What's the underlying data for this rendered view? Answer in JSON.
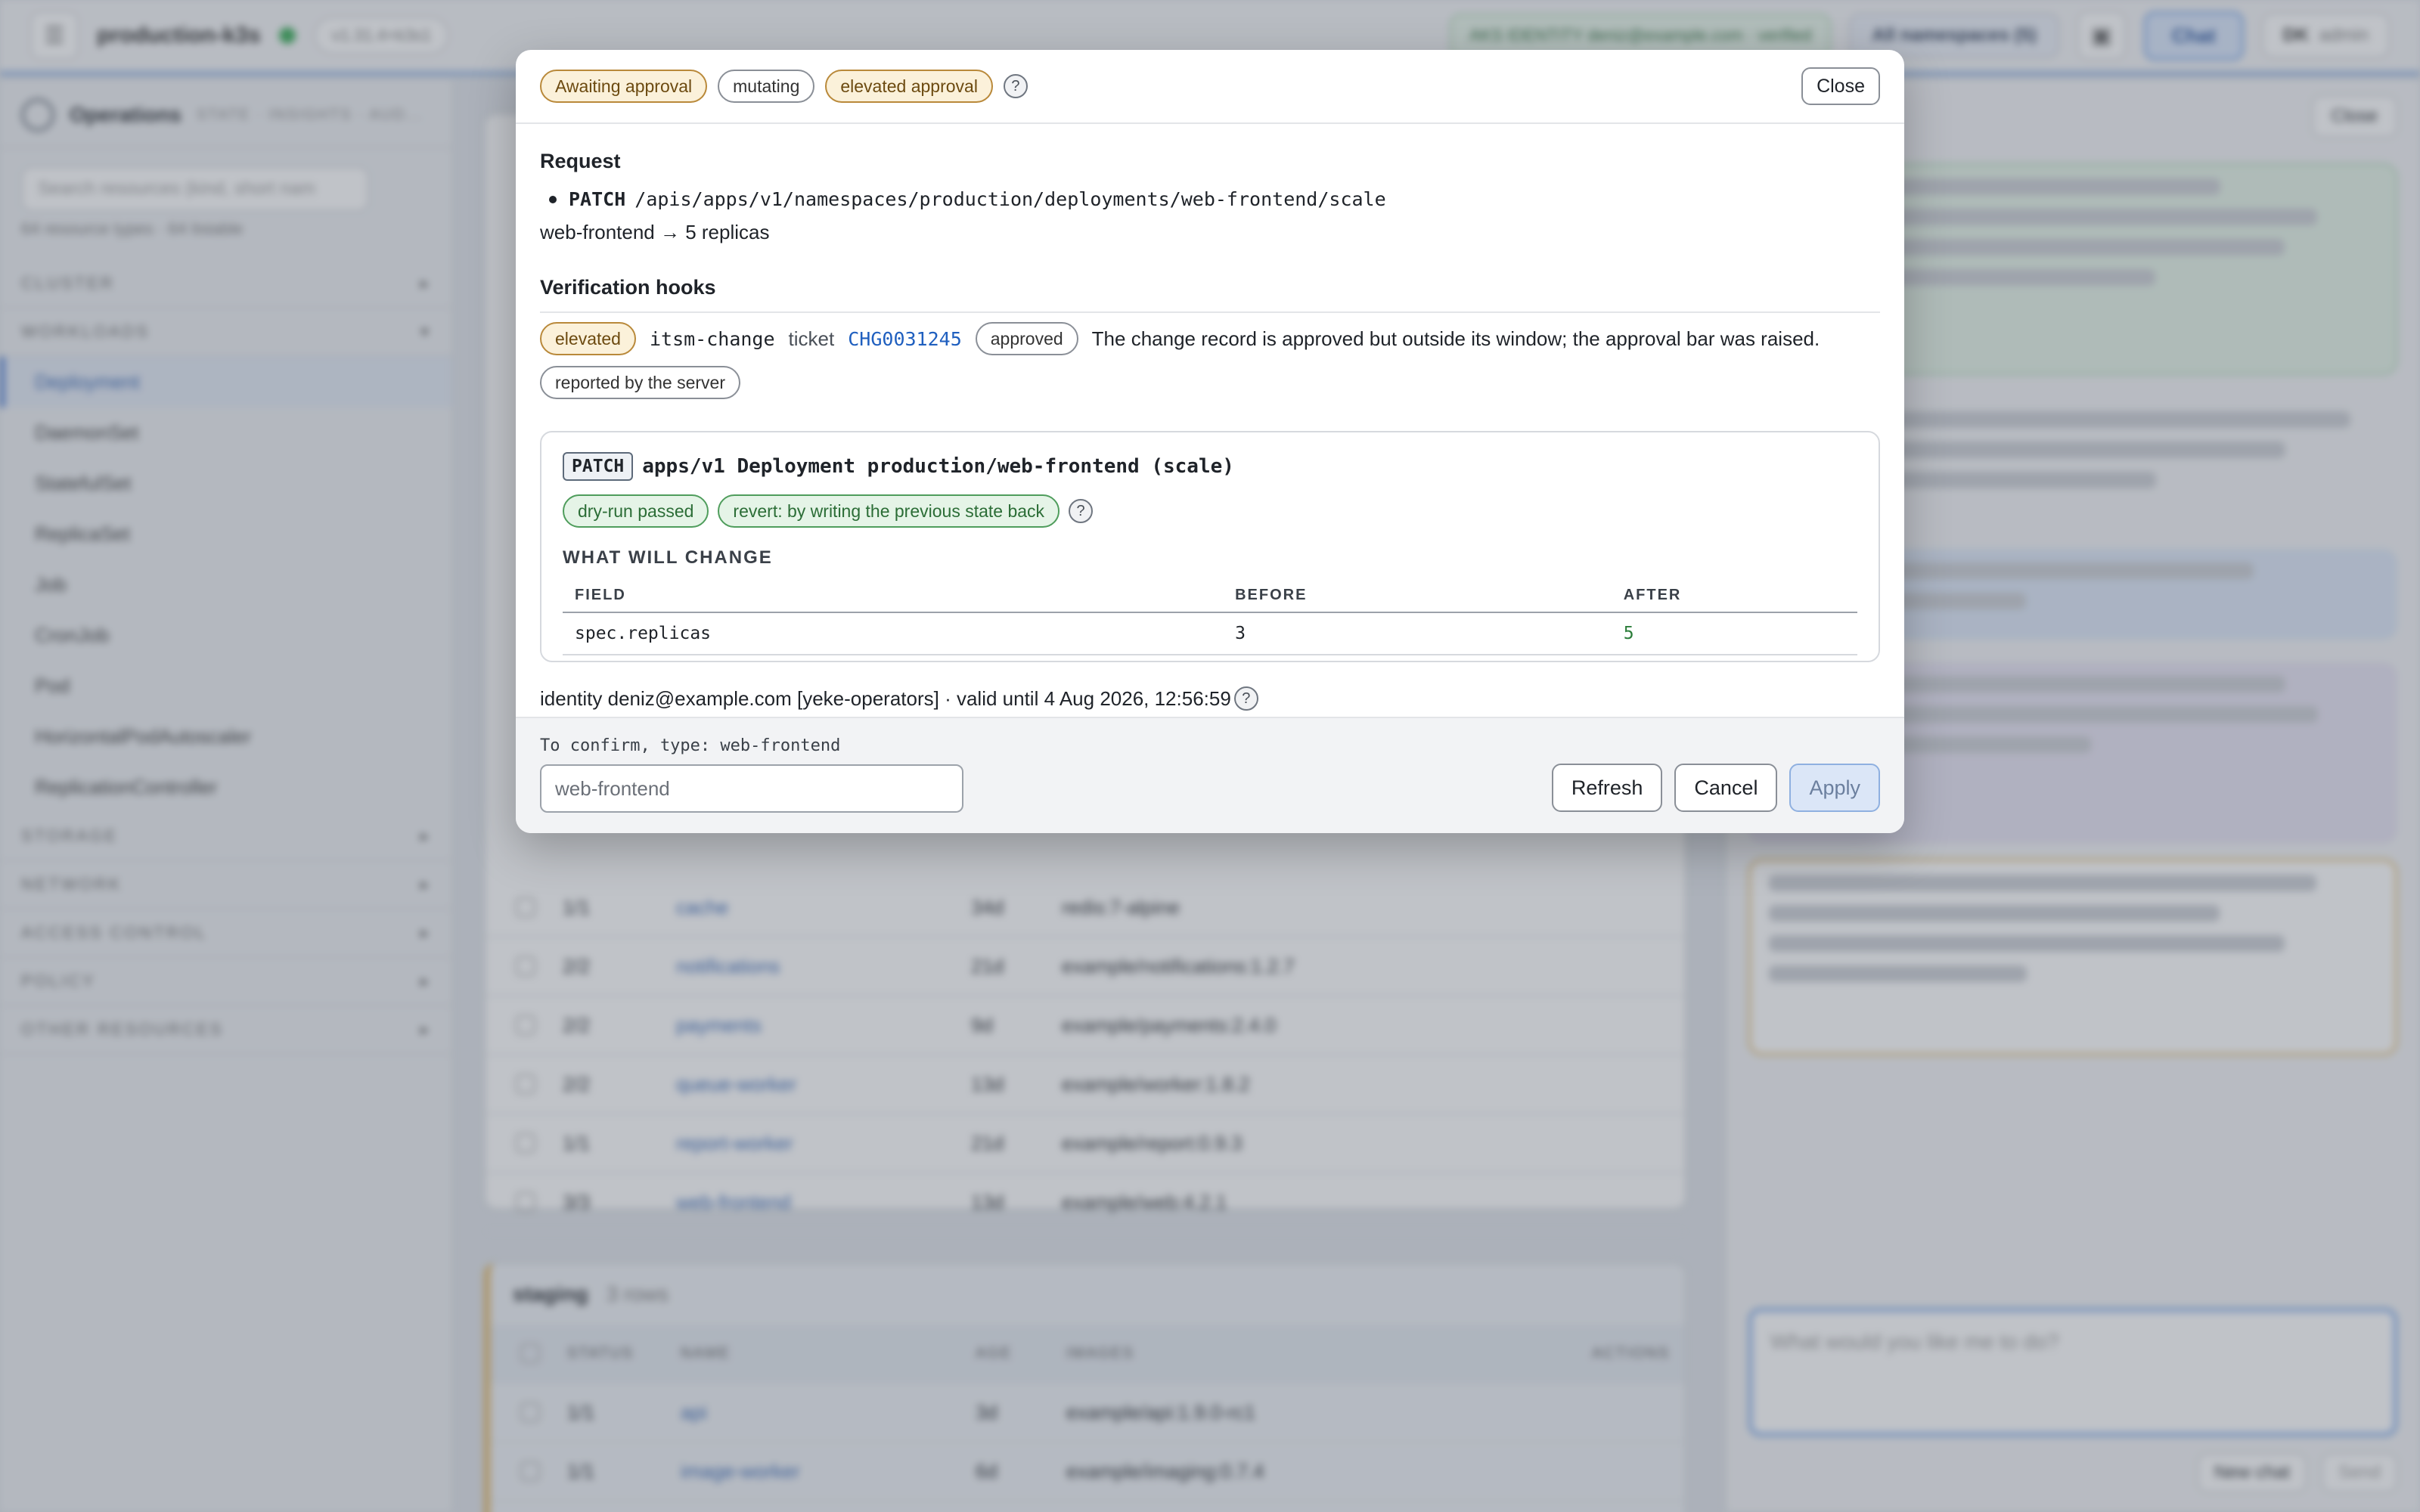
{
  "background": {
    "topbar": {
      "cluster": "production-k3s",
      "version_chip": "v1.31.4+k3s1",
      "identity": "AKS IDENTITY deniz@example.com · verified",
      "namespaces": "All namespaces (5)",
      "chat": "Chat",
      "user_initials": "DK",
      "user_role": "admin"
    },
    "sidebar": {
      "title": "Operations",
      "tabs": "STATE · INSIGHTS · AUD...",
      "search_placeholder": "Search resources (kind, short nam",
      "resource_count": "64 resource types · 64 listable",
      "groups": [
        "CLUSTER",
        "WORKLOADS",
        "STORAGE",
        "NETWORK",
        "ACCESS CONTROL",
        "POLICY",
        "OTHER RESOURCES"
      ],
      "workload_items": [
        "Deployment",
        "DaemonSet",
        "StatefulSet",
        "ReplicaSet",
        "Job",
        "CronJob",
        "Pod",
        "HorizontalPodAutoscaler",
        "ReplicationController"
      ]
    },
    "table_rows": [
      {
        "status": "1/1",
        "name": "cache",
        "age": "34d",
        "image": "redis:7-alpine"
      },
      {
        "status": "2/2",
        "name": "notifications",
        "age": "21d",
        "image": "example/notifications:1.2.7"
      },
      {
        "status": "2/2",
        "name": "payments",
        "age": "9d",
        "image": "example/payments:2.4.0"
      },
      {
        "status": "2/2",
        "name": "queue-worker",
        "age": "13d",
        "image": "example/worker:1.8.2"
      },
      {
        "status": "1/1",
        "name": "report-worker",
        "age": "21d",
        "image": "example/report:0.9.3"
      },
      {
        "status": "3/3",
        "name": "web-frontend",
        "age": "13d",
        "image": "example/web:4.2.1"
      }
    ],
    "staging": {
      "title": "staging",
      "rows_label": "3 rows",
      "headers": [
        "STATUS",
        "NAME",
        "AGE",
        "IMAGES",
        "ACTIONS"
      ],
      "rows": [
        {
          "status": "1/1",
          "name": "api",
          "age": "3d",
          "image": "example/api:1.9.0-rc1"
        },
        {
          "status": "1/1",
          "name": "image-worker",
          "age": "6d",
          "image": "example/imaging:0.7.4"
        }
      ]
    },
    "chat": {
      "close": "Close",
      "input_placeholder": "What would you like me to do?",
      "new_chat": "New chat",
      "send": "Send"
    }
  },
  "modal": {
    "badges": {
      "status": "Awaiting approval",
      "kind": "mutating",
      "approval": "elevated approval"
    },
    "help": "?",
    "close_label": "Close",
    "request": {
      "title": "Request",
      "method": "PATCH",
      "path": "/apis/apps/v1/namespaces/production/deployments/web-frontend/scale",
      "summary": "web-frontend → 5 replicas"
    },
    "hooks": {
      "title": "Verification hooks",
      "level": "elevated",
      "hook_name": "itsm-change",
      "ticket_label": "ticket",
      "ticket_id": "CHG0031245",
      "ticket_status": "approved",
      "message": "The change record is approved but outside its window; the approval bar was raised.",
      "source": "reported by the server"
    },
    "operation": {
      "method": "PATCH",
      "signature": "apps/v1 Deployment production/web-frontend (scale)",
      "dry_run": "dry-run passed",
      "revert": "revert: by writing the previous state back",
      "changes_title": "WHAT WILL CHANGE",
      "columns": [
        "FIELD",
        "BEFORE",
        "AFTER"
      ],
      "changes": [
        {
          "field": "spec.replicas",
          "before": "3",
          "after": "5"
        }
      ]
    },
    "identity": "identity deniz@example.com [yeke-operators] · valid until 4 Aug 2026, 12:56:59",
    "confirm": {
      "label_prefix": "To confirm, type:",
      "label_target": "web-frontend",
      "placeholder": "web-frontend"
    },
    "buttons": {
      "refresh": "Refresh",
      "cancel": "Cancel",
      "apply": "Apply"
    }
  }
}
